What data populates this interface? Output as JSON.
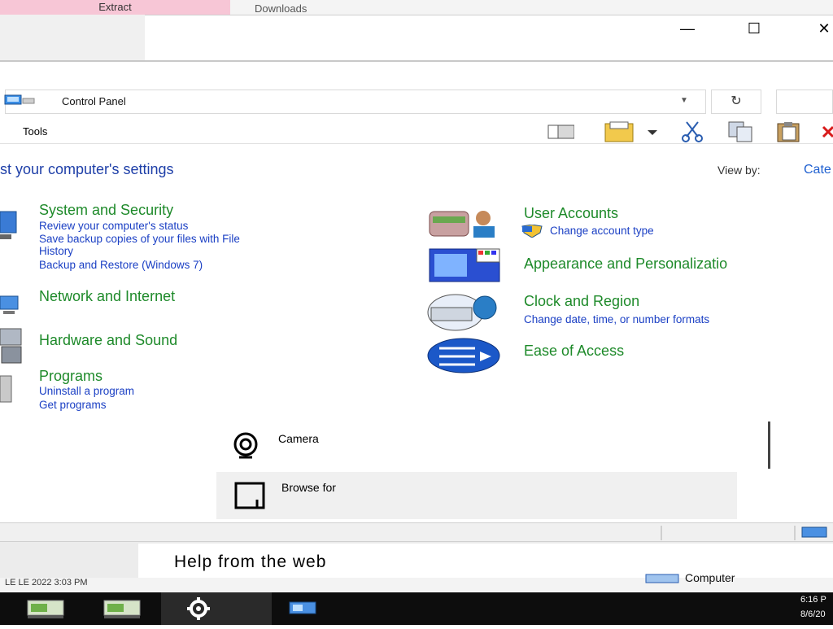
{
  "background_window": {
    "tab_extract": "Extract",
    "tab_downloads": "Downloads"
  },
  "window": {
    "minimize": "—",
    "maximize": "☐",
    "close": "✕"
  },
  "address": {
    "path": "Control Panel",
    "dropdown": "▼",
    "refresh": "↻",
    "search_value": ""
  },
  "menu": {
    "tools": "Tools"
  },
  "toolbar": {
    "icons": [
      "panel-icon",
      "properties-icon",
      "cut-icon",
      "copy-icon",
      "paste-icon",
      "delete-icon"
    ]
  },
  "content": {
    "heading": "st your computer's settings",
    "view_by_label": "View by:",
    "view_by_value": "Cate"
  },
  "categories_left": [
    {
      "title": "System and Security",
      "links": [
        "Review your computer's status",
        "Save backup copies of your files with File",
        "History",
        "Backup and Restore (Windows 7)"
      ]
    },
    {
      "title": "Network and Internet",
      "links": []
    },
    {
      "title": "Hardware and Sound",
      "links": []
    },
    {
      "title": "Programs",
      "links": [
        "Uninstall a program",
        "Get programs"
      ]
    }
  ],
  "categories_right": [
    {
      "title": "User Accounts",
      "links": [
        "Change account type"
      ]
    },
    {
      "title": "Appearance and Personalizatio",
      "links": []
    },
    {
      "title": "Clock and Region",
      "links": [
        "Change date, time, or number formats"
      ]
    },
    {
      "title": "Ease of Access",
      "links": []
    }
  ],
  "popup": {
    "camera": "Camera",
    "browse": "Browse for"
  },
  "help": {
    "text": "Help from the web"
  },
  "under": {
    "left_text": "LE LE 2022 3:03 PM",
    "right_text": "Computer"
  },
  "taskbar": {
    "time": "6:16 P",
    "date": "8/6/20"
  },
  "colors": {
    "category_title": "#1e8a2a",
    "link": "#1a3fc4",
    "heading": "#1e3fa8",
    "taskbar": "#0d0d0d"
  }
}
